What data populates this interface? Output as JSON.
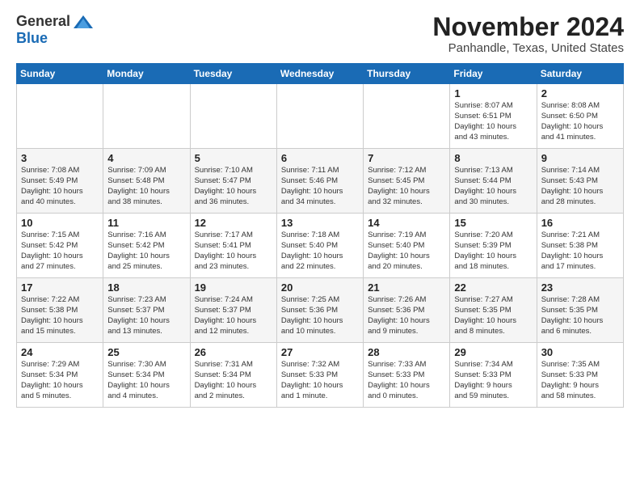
{
  "logo": {
    "general": "General",
    "blue": "Blue"
  },
  "title": {
    "month": "November 2024",
    "location": "Panhandle, Texas, United States"
  },
  "headers": [
    "Sunday",
    "Monday",
    "Tuesday",
    "Wednesday",
    "Thursday",
    "Friday",
    "Saturday"
  ],
  "weeks": [
    [
      {
        "day": "",
        "info": ""
      },
      {
        "day": "",
        "info": ""
      },
      {
        "day": "",
        "info": ""
      },
      {
        "day": "",
        "info": ""
      },
      {
        "day": "",
        "info": ""
      },
      {
        "day": "1",
        "info": "Sunrise: 8:07 AM\nSunset: 6:51 PM\nDaylight: 10 hours\nand 43 minutes."
      },
      {
        "day": "2",
        "info": "Sunrise: 8:08 AM\nSunset: 6:50 PM\nDaylight: 10 hours\nand 41 minutes."
      }
    ],
    [
      {
        "day": "3",
        "info": "Sunrise: 7:08 AM\nSunset: 5:49 PM\nDaylight: 10 hours\nand 40 minutes."
      },
      {
        "day": "4",
        "info": "Sunrise: 7:09 AM\nSunset: 5:48 PM\nDaylight: 10 hours\nand 38 minutes."
      },
      {
        "day": "5",
        "info": "Sunrise: 7:10 AM\nSunset: 5:47 PM\nDaylight: 10 hours\nand 36 minutes."
      },
      {
        "day": "6",
        "info": "Sunrise: 7:11 AM\nSunset: 5:46 PM\nDaylight: 10 hours\nand 34 minutes."
      },
      {
        "day": "7",
        "info": "Sunrise: 7:12 AM\nSunset: 5:45 PM\nDaylight: 10 hours\nand 32 minutes."
      },
      {
        "day": "8",
        "info": "Sunrise: 7:13 AM\nSunset: 5:44 PM\nDaylight: 10 hours\nand 30 minutes."
      },
      {
        "day": "9",
        "info": "Sunrise: 7:14 AM\nSunset: 5:43 PM\nDaylight: 10 hours\nand 28 minutes."
      }
    ],
    [
      {
        "day": "10",
        "info": "Sunrise: 7:15 AM\nSunset: 5:42 PM\nDaylight: 10 hours\nand 27 minutes."
      },
      {
        "day": "11",
        "info": "Sunrise: 7:16 AM\nSunset: 5:42 PM\nDaylight: 10 hours\nand 25 minutes."
      },
      {
        "day": "12",
        "info": "Sunrise: 7:17 AM\nSunset: 5:41 PM\nDaylight: 10 hours\nand 23 minutes."
      },
      {
        "day": "13",
        "info": "Sunrise: 7:18 AM\nSunset: 5:40 PM\nDaylight: 10 hours\nand 22 minutes."
      },
      {
        "day": "14",
        "info": "Sunrise: 7:19 AM\nSunset: 5:40 PM\nDaylight: 10 hours\nand 20 minutes."
      },
      {
        "day": "15",
        "info": "Sunrise: 7:20 AM\nSunset: 5:39 PM\nDaylight: 10 hours\nand 18 minutes."
      },
      {
        "day": "16",
        "info": "Sunrise: 7:21 AM\nSunset: 5:38 PM\nDaylight: 10 hours\nand 17 minutes."
      }
    ],
    [
      {
        "day": "17",
        "info": "Sunrise: 7:22 AM\nSunset: 5:38 PM\nDaylight: 10 hours\nand 15 minutes."
      },
      {
        "day": "18",
        "info": "Sunrise: 7:23 AM\nSunset: 5:37 PM\nDaylight: 10 hours\nand 13 minutes."
      },
      {
        "day": "19",
        "info": "Sunrise: 7:24 AM\nSunset: 5:37 PM\nDaylight: 10 hours\nand 12 minutes."
      },
      {
        "day": "20",
        "info": "Sunrise: 7:25 AM\nSunset: 5:36 PM\nDaylight: 10 hours\nand 10 minutes."
      },
      {
        "day": "21",
        "info": "Sunrise: 7:26 AM\nSunset: 5:36 PM\nDaylight: 10 hours\nand 9 minutes."
      },
      {
        "day": "22",
        "info": "Sunrise: 7:27 AM\nSunset: 5:35 PM\nDaylight: 10 hours\nand 8 minutes."
      },
      {
        "day": "23",
        "info": "Sunrise: 7:28 AM\nSunset: 5:35 PM\nDaylight: 10 hours\nand 6 minutes."
      }
    ],
    [
      {
        "day": "24",
        "info": "Sunrise: 7:29 AM\nSunset: 5:34 PM\nDaylight: 10 hours\nand 5 minutes."
      },
      {
        "day": "25",
        "info": "Sunrise: 7:30 AM\nSunset: 5:34 PM\nDaylight: 10 hours\nand 4 minutes."
      },
      {
        "day": "26",
        "info": "Sunrise: 7:31 AM\nSunset: 5:34 PM\nDaylight: 10 hours\nand 2 minutes."
      },
      {
        "day": "27",
        "info": "Sunrise: 7:32 AM\nSunset: 5:33 PM\nDaylight: 10 hours\nand 1 minute."
      },
      {
        "day": "28",
        "info": "Sunrise: 7:33 AM\nSunset: 5:33 PM\nDaylight: 10 hours\nand 0 minutes."
      },
      {
        "day": "29",
        "info": "Sunrise: 7:34 AM\nSunset: 5:33 PM\nDaylight: 9 hours\nand 59 minutes."
      },
      {
        "day": "30",
        "info": "Sunrise: 7:35 AM\nSunset: 5:33 PM\nDaylight: 9 hours\nand 58 minutes."
      }
    ]
  ]
}
